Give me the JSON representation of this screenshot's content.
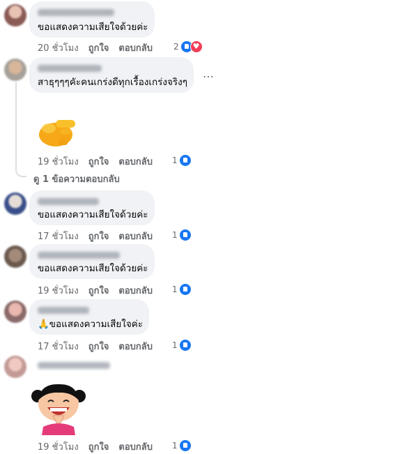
{
  "comments": [
    {
      "text": "ขอแสดงความเสียใจด้วยค่ะ",
      "time": "20 ชั่วโมง",
      "like": "ถูกใจ",
      "reply": "ตอบกลับ",
      "count": "2",
      "reactions": [
        "like-icon",
        "love-icon"
      ]
    },
    {
      "text": "สาธุๆๆๆคัะคนเกร่งดีทุกเรื้องเกร่งจริงๆ",
      "time": "19 ชั่วโมง",
      "like": "ถูกใจ",
      "reply": "ตอบกลับ",
      "count": "1",
      "reactions": [
        "like-icon"
      ],
      "sticker": "thumbs-hand-sticker",
      "more": "…"
    },
    {
      "text": "ขอแสดงความเสียใจด้วยค่ะ",
      "time": "17 ชั่วโมง",
      "like": "ถูกใจ",
      "reply": "ตอบกลับ",
      "count": "1",
      "reactions": [
        "like-icon"
      ]
    },
    {
      "text": "ขอแสดงความเสียใจด้วยค่ะ",
      "time": "19 ชั่วโมง",
      "like": "ถูกใจ",
      "reply": "ตอบกลับ",
      "count": "1",
      "reactions": [
        "like-icon"
      ]
    },
    {
      "text": "🙏ขอแสดงความเสียใจค่ะ",
      "time": "17 ชั่วโมง",
      "like": "ถูกใจ",
      "reply": "ตอบกลับ",
      "count": "1",
      "reactions": [
        "like-icon"
      ]
    },
    {
      "time": "19 ชั่วโมง",
      "like": "ถูกใจ",
      "reply": "ตอบกลับ",
      "count": "1",
      "reactions": [
        "like-icon"
      ],
      "sticker": "praying-girl-sticker"
    }
  ],
  "view_replies": "ดู 1 ข้อความตอบกลับ",
  "colors": {
    "bubble": "#f0f2f5",
    "like": "#1877f2",
    "love": "#f33e58",
    "meta": "#65676b"
  }
}
